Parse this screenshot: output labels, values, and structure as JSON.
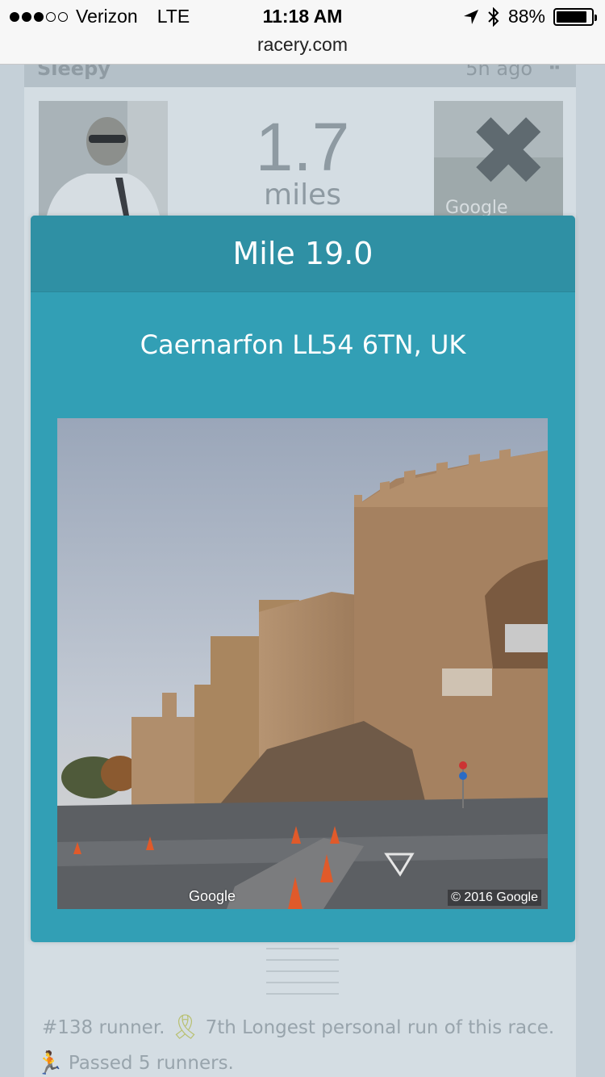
{
  "status_bar": {
    "carrier": "Verizon",
    "network": "LTE",
    "time": "11:18 AM",
    "url": "racery.com",
    "battery": "88%",
    "battery_level": 0.88,
    "signal_bars_filled": 3,
    "signal_bars_total": 5,
    "icons": [
      "location-arrow-icon",
      "bluetooth-icon",
      "battery-icon"
    ]
  },
  "background_card": {
    "runner_name": "Sleepy",
    "time_ago": "5h ago",
    "distance_value": "1.7",
    "distance_unit": "miles",
    "map_brand": "Google",
    "feats": [
      {
        "text": "#138 runner.",
        "icon": "ribbon-icon",
        "text2": "7th Longest personal run of this race."
      },
      {
        "icon": "runners-icon",
        "text": "Passed 5 runners."
      }
    ]
  },
  "modal": {
    "title": "Mile 19.0",
    "address": "Caernarfon LL54 6TN, UK",
    "photo": {
      "logo": "Google",
      "copyright": "© 2016 Google"
    }
  },
  "colors": {
    "modal_body": "#329fb5",
    "modal_header": "#2f90a4",
    "overlay_tint": "#c9d4dc"
  }
}
